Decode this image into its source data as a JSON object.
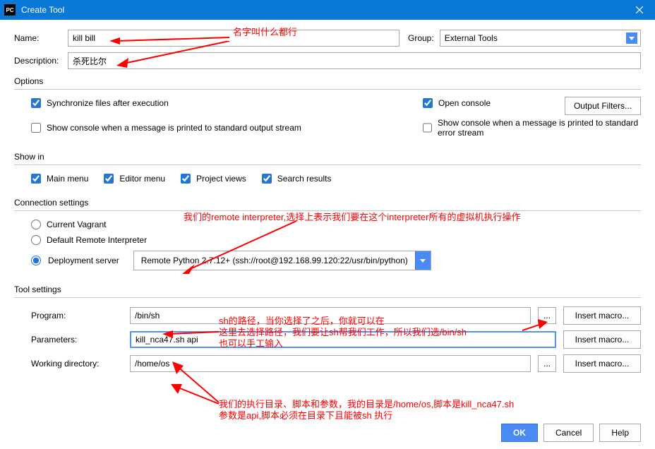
{
  "window": {
    "title": "Create Tool"
  },
  "form": {
    "name_label": "Name:",
    "name_value": "kill bill",
    "group_label": "Group:",
    "group_value": "External Tools",
    "desc_label": "Description:",
    "desc_value": "杀死比尔"
  },
  "options": {
    "head": "Options",
    "sync": "Synchronize files after execution",
    "open_console": "Open console",
    "show_stdout": "Show console when a message is printed to standard output stream",
    "show_stderr": "Show console when a message is printed to standard error stream",
    "output_filters": "Output Filters..."
  },
  "showin": {
    "head": "Show in",
    "main_menu": "Main menu",
    "editor_menu": "Editor menu",
    "project_views": "Project views",
    "search_results": "Search results"
  },
  "conn": {
    "head": "Connection settings",
    "vagrant": "Current Vagrant",
    "default_remote": "Default Remote Interpreter",
    "deploy": "Deployment server",
    "deploy_value": "Remote Python 2.7.12+ (ssh://root@192.168.99.120:22/usr/bin/python)"
  },
  "tool": {
    "head": "Tool settings",
    "program_label": "Program:",
    "program_value": "/bin/sh",
    "params_label": "Parameters:",
    "params_value": "kill_nca47.sh api",
    "wd_label": "Working directory:",
    "wd_value": "/home/os",
    "insert_macro": "Insert macro..."
  },
  "footer": {
    "ok": "OK",
    "cancel": "Cancel",
    "help": "Help"
  },
  "anno": {
    "a1": "名字叫什么都行",
    "a2": "我们的remote interpreter,选择上表示我们要在这个interpreter所有的虚拟机执行操作",
    "a3": "sh的路径，当你选择了之后，你就可以在\n这里去选择路径，我们要让sh帮我们工作，所以我们选/bin/sh\n也可以手工输入",
    "a4": "我们的执行目录、脚本和参数，我的目录是/home/os,脚本是kill_nca47.sh\n参数是api,脚本必须在目录下且能被sh 执行"
  }
}
